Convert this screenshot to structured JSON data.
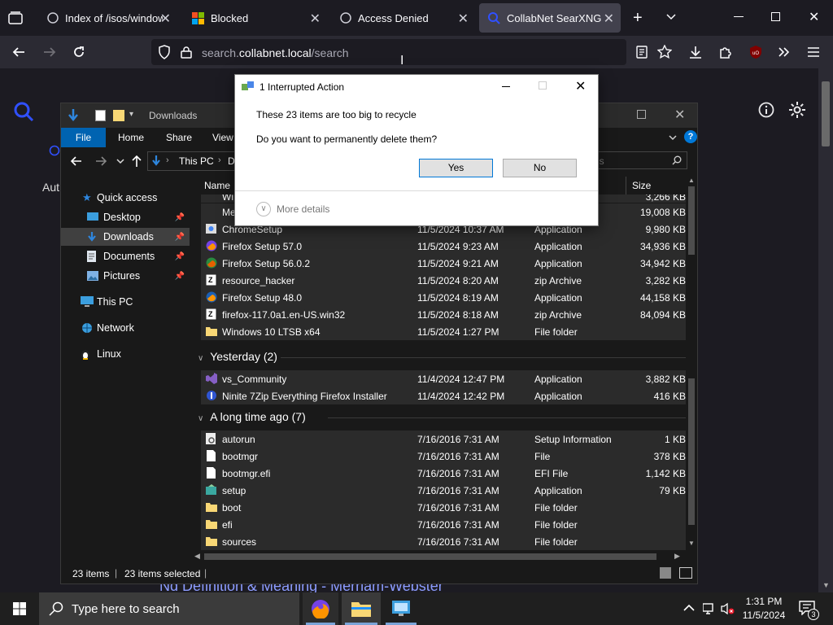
{
  "browser": {
    "tabs": [
      {
        "label": "Index of /isos/windows"
      },
      {
        "label": "Blocked"
      },
      {
        "label": "Access Denied"
      },
      {
        "label": "CollabNet SearXNG"
      }
    ],
    "url_prefix": "search.",
    "url_domain": "collabnet.local",
    "url_path": "/search",
    "page_left_text": "Aut",
    "page_bottom_text": "Nd Definition & Meaning - Merriam-Webster"
  },
  "explorer": {
    "title": "Downloads",
    "ribbon_tabs": [
      "File",
      "Home",
      "Share",
      "View"
    ],
    "breadcrumb": [
      "This PC",
      "D"
    ],
    "search_placeholder": "ds",
    "column_name": "Name",
    "column_size": "Size",
    "nav": [
      {
        "label": "Quick access",
        "pinned": false
      },
      {
        "label": "Desktop",
        "pinned": true
      },
      {
        "label": "Downloads",
        "pinned": true
      },
      {
        "label": "Documents",
        "pinned": true
      },
      {
        "label": "Pictures",
        "pinned": true
      },
      {
        "label": "This PC",
        "pinned": false
      },
      {
        "label": "Network",
        "pinned": false
      },
      {
        "label": "Linux",
        "pinned": false
      }
    ],
    "partial_rows": [
      {
        "name": "Wi",
        "size": "3,266 KB"
      },
      {
        "name": "Me",
        "size": "19,008 KB"
      }
    ],
    "today_rows": [
      {
        "name": "ChromeSetup",
        "date": "11/5/2024 10:37 AM",
        "type": "Application",
        "size": "9,980 KB"
      },
      {
        "name": "Firefox Setup 57.0",
        "date": "11/5/2024 9:23 AM",
        "type": "Application",
        "size": "34,936 KB"
      },
      {
        "name": "Firefox Setup 56.0.2",
        "date": "11/5/2024 9:21 AM",
        "type": "Application",
        "size": "34,942 KB"
      },
      {
        "name": "resource_hacker",
        "date": "11/5/2024 8:20 AM",
        "type": "zip Archive",
        "size": "3,282 KB"
      },
      {
        "name": "Firefox Setup 48.0",
        "date": "11/5/2024 8:19 AM",
        "type": "Application",
        "size": "44,158 KB"
      },
      {
        "name": "firefox-117.0a1.en-US.win32",
        "date": "11/5/2024 8:18 AM",
        "type": "zip Archive",
        "size": "84,094 KB"
      },
      {
        "name": "Windows 10 LTSB x64",
        "date": "11/5/2024 1:27 PM",
        "type": "File folder",
        "size": ""
      }
    ],
    "group_yesterday": "Yesterday (2)",
    "yesterday_rows": [
      {
        "name": "vs_Community",
        "date": "11/4/2024 12:47 PM",
        "type": "Application",
        "size": "3,882 KB"
      },
      {
        "name": "Ninite 7Zip Everything Firefox Installer",
        "date": "11/4/2024 12:42 PM",
        "type": "Application",
        "size": "416 KB"
      }
    ],
    "group_longago": "A long time ago (7)",
    "longago_rows": [
      {
        "name": "autorun",
        "date": "7/16/2016 7:31 AM",
        "type": "Setup Information",
        "size": "1 KB"
      },
      {
        "name": "bootmgr",
        "date": "7/16/2016 7:31 AM",
        "type": "File",
        "size": "378 KB"
      },
      {
        "name": "bootmgr.efi",
        "date": "7/16/2016 7:31 AM",
        "type": "EFI File",
        "size": "1,142 KB"
      },
      {
        "name": "setup",
        "date": "7/16/2016 7:31 AM",
        "type": "Application",
        "size": "79 KB"
      },
      {
        "name": "boot",
        "date": "7/16/2016 7:31 AM",
        "type": "File folder",
        "size": ""
      },
      {
        "name": "efi",
        "date": "7/16/2016 7:31 AM",
        "type": "File folder",
        "size": ""
      },
      {
        "name": "sources",
        "date": "7/16/2016 7:31 AM",
        "type": "File folder",
        "size": ""
      }
    ],
    "status_items": "23 items",
    "status_selected": "23 items selected"
  },
  "dialog": {
    "title": "1 Interrupted Action",
    "message": "These 23 items are too big to recycle",
    "question": "Do you want to permanently delete them?",
    "yes": "Yes",
    "no": "No",
    "more_details": "More details"
  },
  "taskbar": {
    "search_placeholder": "Type here to search",
    "time": "1:31 PM",
    "date": "11/5/2024",
    "notification_count": "3"
  },
  "colors": {
    "accent": "#0078d7",
    "folder": "#f8d775",
    "row_selected": "#2b2b2b"
  }
}
